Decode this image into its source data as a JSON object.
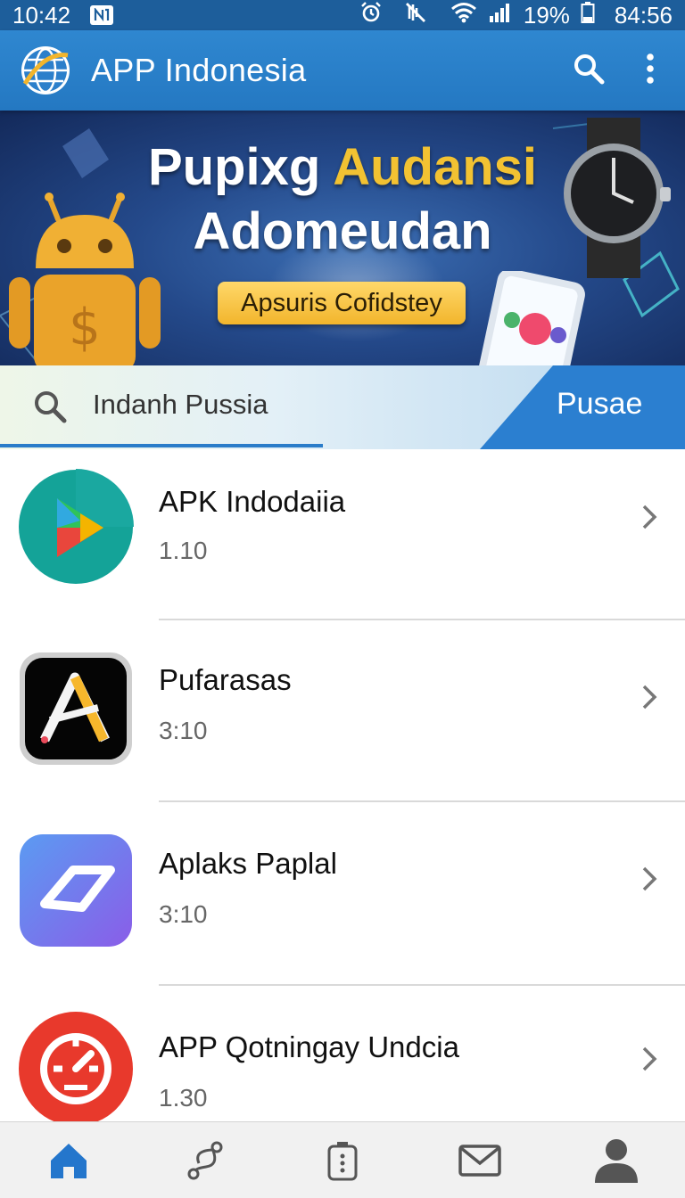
{
  "status_bar": {
    "time_left": "10:42",
    "battery": "19%",
    "time_right": "84:56",
    "icons": [
      "notification-icon",
      "alarm-icon",
      "mute-icon",
      "wifi-icon",
      "signal-icon",
      "battery-icon"
    ]
  },
  "app_bar": {
    "title": "APP Indonesia",
    "logo": "globe-logo",
    "actions": [
      "search-icon",
      "more-vert-icon"
    ]
  },
  "banner": {
    "title_part1": "Pupixg ",
    "title_part2": "Audansi",
    "title_line2": "Adomeudan",
    "cta": "Apsuris Cofidstey",
    "accent_color": "#f2c232"
  },
  "search": {
    "value": "Indanh Pussia",
    "button": "Pusae"
  },
  "apps": [
    {
      "name": "APK Indodaiia",
      "version": "1.10",
      "icon": "play-store-icon"
    },
    {
      "name": "Pufarasas",
      "version": "3:10",
      "icon": "letter-a-app-icon"
    },
    {
      "name": "Aplaks Paplal",
      "version": "3:10",
      "icon": "paper-plane-app-icon"
    },
    {
      "name": "APP Qotningay Undcia",
      "version": "1.30",
      "icon": "speed-gauge-app-icon"
    }
  ],
  "bottom_nav": [
    "home-icon",
    "route-icon",
    "battery-status-icon",
    "mail-icon",
    "profile-icon"
  ],
  "colors": {
    "primary": "#2478c2",
    "status_bar": "#1d5e9b",
    "nav_active": "#2476cc"
  }
}
